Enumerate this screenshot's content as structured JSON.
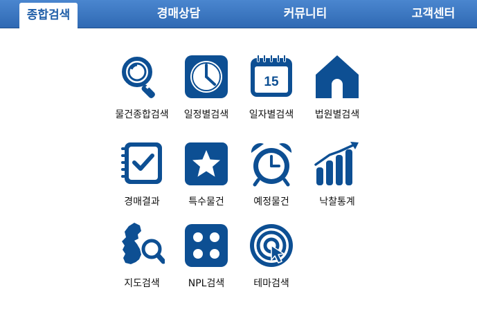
{
  "nav": {
    "tabs": [
      {
        "label": "종합검색",
        "active": true
      },
      {
        "label": "경매상담",
        "active": false
      },
      {
        "label": "커뮤니티",
        "active": false
      },
      {
        "label": "고객센터",
        "active": false
      }
    ]
  },
  "menu": {
    "items": [
      {
        "label": "물건종합검색",
        "icon": "magnifier-icon"
      },
      {
        "label": "일정별검색",
        "icon": "clock-icon"
      },
      {
        "label": "일자별검색",
        "icon": "calendar-icon",
        "calendar_day": "15"
      },
      {
        "label": "법원별검색",
        "icon": "house-icon"
      },
      {
        "label": "경매결과",
        "icon": "checklist-icon"
      },
      {
        "label": "특수물건",
        "icon": "star-icon"
      },
      {
        "label": "예정물건",
        "icon": "alarm-clock-icon"
      },
      {
        "label": "낙찰통계",
        "icon": "bar-chart-icon"
      },
      {
        "label": "지도검색",
        "icon": "map-search-icon"
      },
      {
        "label": "NPL검색",
        "icon": "dice-icon"
      },
      {
        "label": "테마검색",
        "icon": "target-icon"
      }
    ]
  },
  "colors": {
    "nav_bg": "#3a76c1",
    "icon_blue": "#0d4f93",
    "text": "#111111"
  }
}
